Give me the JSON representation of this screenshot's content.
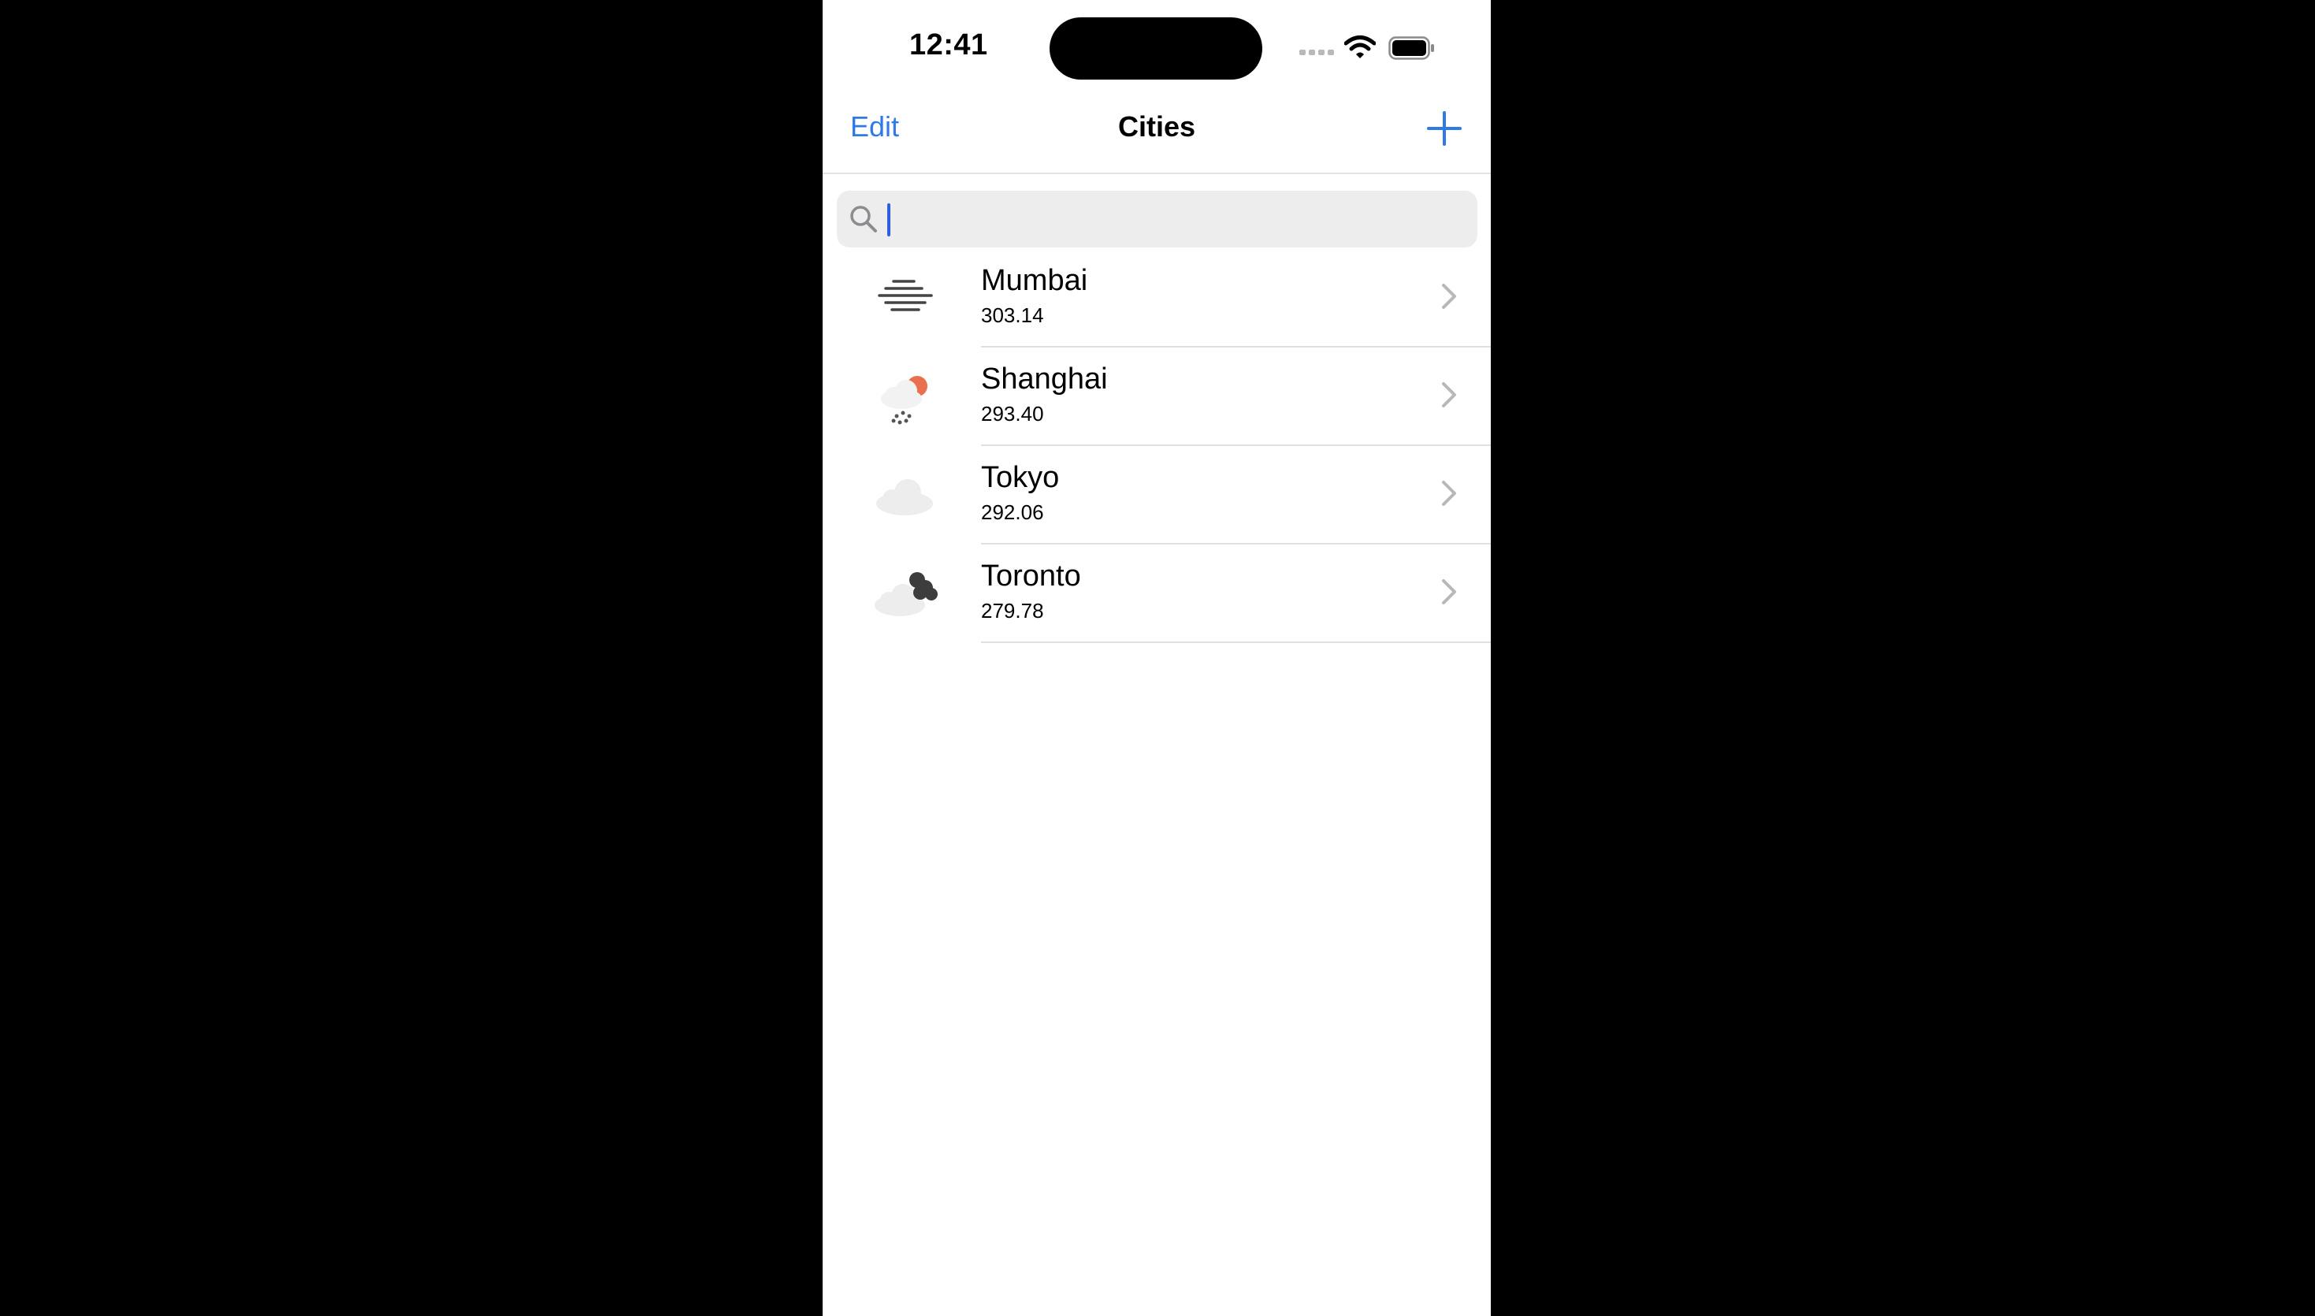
{
  "status_bar": {
    "time": "12:41"
  },
  "nav": {
    "edit_label": "Edit",
    "title": "Cities",
    "add_icon": "plus-icon"
  },
  "search": {
    "value": "",
    "icon": "search-icon"
  },
  "cities": [
    {
      "name": "Mumbai",
      "value": "303.14",
      "icon": "haze-icon"
    },
    {
      "name": "Shanghai",
      "value": "293.40",
      "icon": "cloud-sun-rain-icon"
    },
    {
      "name": "Tokyo",
      "value": "292.06",
      "icon": "cloud-icon"
    },
    {
      "name": "Toronto",
      "value": "279.78",
      "icon": "broken-clouds-icon"
    }
  ],
  "colors": {
    "accent": "#2f7ae5",
    "sun": "#e8704f",
    "dark_cloud": "#3d3d3d",
    "light_cloud": "#ededed"
  }
}
